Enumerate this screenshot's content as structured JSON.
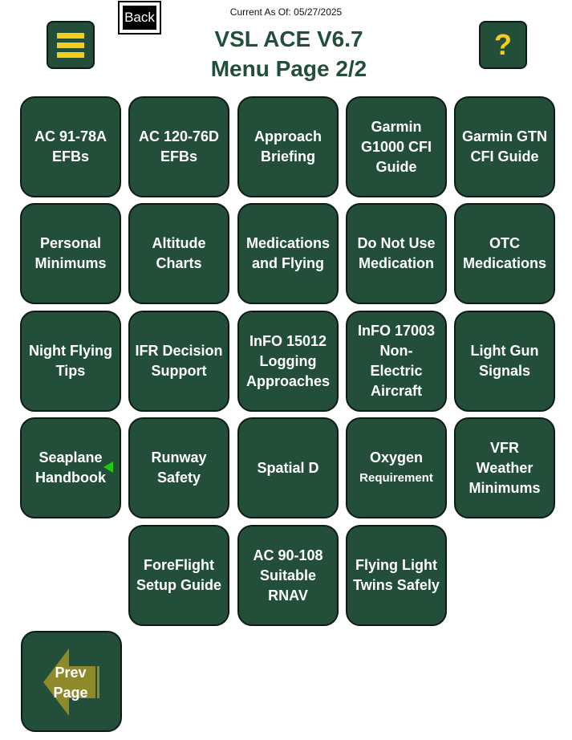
{
  "header": {
    "updated_label": "Current As Of:",
    "updated_date": "05/27/2025",
    "back_label": "Back",
    "title_line1": "VSL ACE V6.7",
    "title_line2": "Menu Page 2/2",
    "menu_icon": "hamburger-menu-icon",
    "help_label": "?"
  },
  "colors": {
    "tile_bg": "#234f3a",
    "tile_border": "#0c1c14",
    "accent_yellow": "#f4ce1e",
    "title_green": "#234f3a",
    "arrow_olive": "#8e8a2c",
    "marker_green": "#22c80a"
  },
  "tiles": [
    {
      "label": "AC 91-78A\nEFBs"
    },
    {
      "label": "AC 120-76D\nEFBs"
    },
    {
      "label": "Approach\nBriefing"
    },
    {
      "label": "Garmin\nG1000 CFI\nGuide"
    },
    {
      "label": "Garmin GTN\nCFI Guide"
    },
    {
      "label": "Personal\nMinimums"
    },
    {
      "label": "Altitude\nCharts"
    },
    {
      "label": "Medications\nand Flying"
    },
    {
      "label": "Do Not Use\nMedication"
    },
    {
      "label": "OTC\nMedications"
    },
    {
      "label": "Night Flying\nTips"
    },
    {
      "label": "IFR Decision\nSupport"
    },
    {
      "label": "InFO 15012\nLogging\nApproaches"
    },
    {
      "label": "InFO 17003\nNon-\nElectric\nAircraft"
    },
    {
      "label": "Light Gun\nSignals"
    },
    {
      "label": "Seaplane\nHandbook"
    },
    {
      "label": "Runway\nSafety"
    },
    {
      "label": "Spatial D"
    },
    {
      "label": "Oxygen",
      "sublabel": "Requirement"
    },
    {
      "label": "VFR\nWeather\nMinimums"
    },
    {
      "label": "ForeFlight\nSetup Guide"
    },
    {
      "label": "AC 90-108\nSuitable\nRNAV"
    },
    {
      "label": "Flying Light\nTwins Safely"
    }
  ],
  "prev_page": {
    "label": "Prev\nPage",
    "icon": "left-arrow-icon"
  }
}
